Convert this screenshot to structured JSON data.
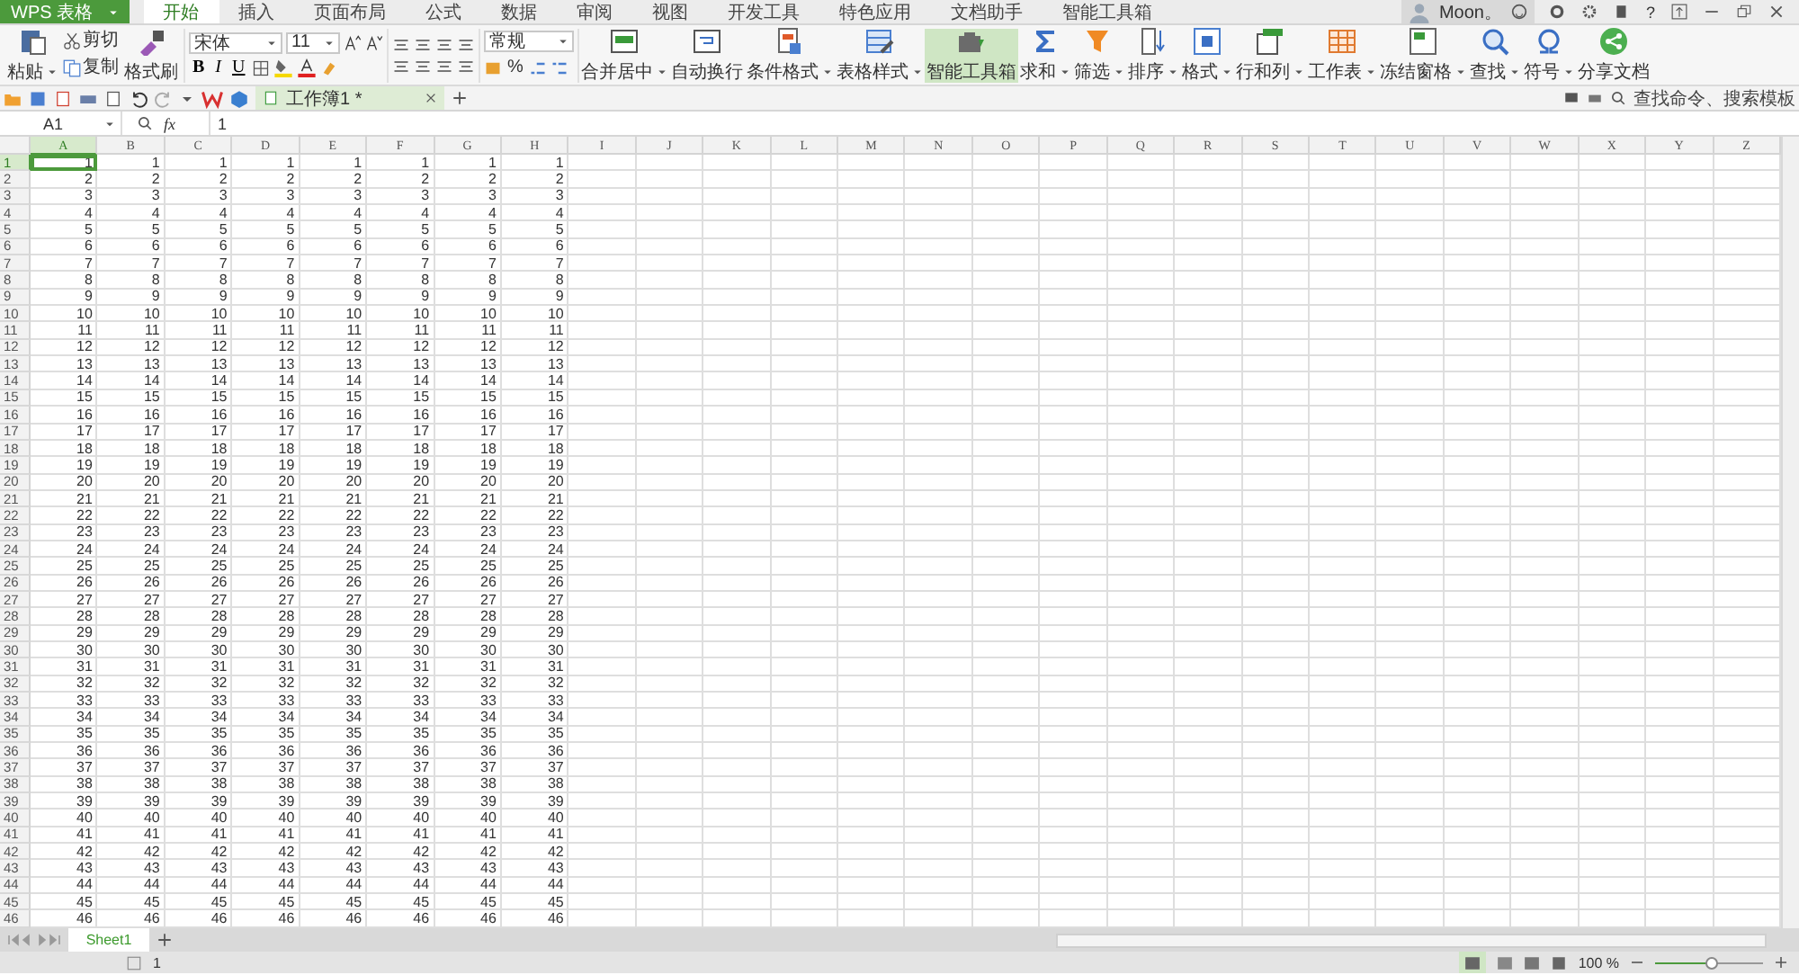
{
  "app_button": {
    "label": "WPS 表格"
  },
  "menu_tabs": [
    {
      "label": "开始",
      "selected": true
    },
    {
      "label": "插入",
      "selected": false
    },
    {
      "label": "页面布局",
      "selected": false
    },
    {
      "label": "公式",
      "selected": false
    },
    {
      "label": "数据",
      "selected": false
    },
    {
      "label": "审阅",
      "selected": false
    },
    {
      "label": "视图",
      "selected": false
    },
    {
      "label": "开发工具",
      "selected": false
    },
    {
      "label": "特色应用",
      "selected": false
    },
    {
      "label": "文档助手",
      "selected": false
    },
    {
      "label": "智能工具箱",
      "selected": false
    }
  ],
  "user": {
    "name": "Moon。",
    "help": "?"
  },
  "ribbon": {
    "clipboard": {
      "paste": "粘贴",
      "cut": "剪切",
      "copy": "复制",
      "format_painter": "格式刷"
    },
    "font": {
      "name": "宋体",
      "size": "11",
      "bold": "B",
      "italic": "I",
      "underline": "U"
    },
    "number": {
      "format": "常规",
      "percent": "%"
    },
    "large_buttons": [
      {
        "label": "合并居中",
        "kind": "merge",
        "dropdown": true,
        "selected": false
      },
      {
        "label": "自动换行",
        "kind": "wrap",
        "dropdown": false,
        "selected": false
      },
      {
        "label": "条件格式",
        "kind": "conditional",
        "dropdown": true,
        "selected": false
      },
      {
        "label": "表格样式",
        "kind": "style",
        "dropdown": true,
        "selected": false
      },
      {
        "label": "智能工具箱",
        "kind": "toolbox",
        "dropdown": false,
        "selected": true
      },
      {
        "label": "求和",
        "kind": "sum",
        "dropdown": true,
        "selected": false
      },
      {
        "label": "筛选",
        "kind": "filter",
        "dropdown": true,
        "selected": false
      },
      {
        "label": "排序",
        "kind": "sort",
        "dropdown": true,
        "selected": false
      },
      {
        "label": "格式",
        "kind": "format",
        "dropdown": true,
        "selected": false
      },
      {
        "label": "行和列",
        "kind": "rowcol",
        "dropdown": true,
        "selected": false
      },
      {
        "label": "工作表",
        "kind": "sheet",
        "dropdown": true,
        "selected": false
      },
      {
        "label": "冻结窗格",
        "kind": "freeze",
        "dropdown": true,
        "selected": false
      },
      {
        "label": "查找",
        "kind": "find",
        "dropdown": true,
        "selected": false
      },
      {
        "label": "符号",
        "kind": "symbol",
        "dropdown": true,
        "selected": false
      },
      {
        "label": "分享文档",
        "kind": "share",
        "dropdown": false,
        "selected": false
      }
    ]
  },
  "quick_bar": {
    "document_tab": "工作簿1 *",
    "search": {
      "placeholder": "查找命令、搜索模板"
    }
  },
  "formula_bar": {
    "cell_ref": "A1",
    "fx": "fx",
    "value": "1"
  },
  "sheet": {
    "columns": [
      {
        "label": "A",
        "selected": true
      },
      {
        "label": "B",
        "selected": false
      },
      {
        "label": "C",
        "selected": false
      },
      {
        "label": "D",
        "selected": false
      },
      {
        "label": "E",
        "selected": false
      },
      {
        "label": "F",
        "selected": false
      },
      {
        "label": "G",
        "selected": false
      },
      {
        "label": "H",
        "selected": false
      },
      {
        "label": "I",
        "selected": false
      },
      {
        "label": "J",
        "selected": false
      },
      {
        "label": "K",
        "selected": false
      },
      {
        "label": "L",
        "selected": false
      },
      {
        "label": "M",
        "selected": false
      },
      {
        "label": "N",
        "selected": false
      },
      {
        "label": "O",
        "selected": false
      },
      {
        "label": "P",
        "selected": false
      },
      {
        "label": "Q",
        "selected": false
      },
      {
        "label": "R",
        "selected": false
      },
      {
        "label": "S",
        "selected": false
      },
      {
        "label": "T",
        "selected": false
      },
      {
        "label": "U",
        "selected": false
      },
      {
        "label": "V",
        "selected": false
      },
      {
        "label": "W",
        "selected": false
      },
      {
        "label": "X",
        "selected": false
      },
      {
        "label": "Y",
        "selected": false
      },
      {
        "label": "Z",
        "selected": false
      }
    ],
    "rows": [
      {
        "label": "1",
        "selected": true,
        "cells": [
          "1",
          "1",
          "1",
          "1",
          "1",
          "1",
          "1",
          "1"
        ]
      },
      {
        "label": "2",
        "selected": false,
        "cells": [
          "2",
          "2",
          "2",
          "2",
          "2",
          "2",
          "2",
          "2"
        ]
      },
      {
        "label": "3",
        "selected": false,
        "cells": [
          "3",
          "3",
          "3",
          "3",
          "3",
          "3",
          "3",
          "3"
        ]
      },
      {
        "label": "4",
        "selected": false,
        "cells": [
          "4",
          "4",
          "4",
          "4",
          "4",
          "4",
          "4",
          "4"
        ]
      },
      {
        "label": "5",
        "selected": false,
        "cells": [
          "5",
          "5",
          "5",
          "5",
          "5",
          "5",
          "5",
          "5"
        ]
      },
      {
        "label": "6",
        "selected": false,
        "cells": [
          "6",
          "6",
          "6",
          "6",
          "6",
          "6",
          "6",
          "6"
        ]
      },
      {
        "label": "7",
        "selected": false,
        "cells": [
          "7",
          "7",
          "7",
          "7",
          "7",
          "7",
          "7",
          "7"
        ]
      },
      {
        "label": "8",
        "selected": false,
        "cells": [
          "8",
          "8",
          "8",
          "8",
          "8",
          "8",
          "8",
          "8"
        ]
      },
      {
        "label": "9",
        "selected": false,
        "cells": [
          "9",
          "9",
          "9",
          "9",
          "9",
          "9",
          "9",
          "9"
        ]
      },
      {
        "label": "10",
        "selected": false,
        "cells": [
          "10",
          "10",
          "10",
          "10",
          "10",
          "10",
          "10",
          "10"
        ]
      },
      {
        "label": "11",
        "selected": false,
        "cells": [
          "11",
          "11",
          "11",
          "11",
          "11",
          "11",
          "11",
          "11"
        ]
      },
      {
        "label": "12",
        "selected": false,
        "cells": [
          "12",
          "12",
          "12",
          "12",
          "12",
          "12",
          "12",
          "12"
        ]
      },
      {
        "label": "13",
        "selected": false,
        "cells": [
          "13",
          "13",
          "13",
          "13",
          "13",
          "13",
          "13",
          "13"
        ]
      },
      {
        "label": "14",
        "selected": false,
        "cells": [
          "14",
          "14",
          "14",
          "14",
          "14",
          "14",
          "14",
          "14"
        ]
      },
      {
        "label": "15",
        "selected": false,
        "cells": [
          "15",
          "15",
          "15",
          "15",
          "15",
          "15",
          "15",
          "15"
        ]
      },
      {
        "label": "16",
        "selected": false,
        "cells": [
          "16",
          "16",
          "16",
          "16",
          "16",
          "16",
          "16",
          "16"
        ]
      },
      {
        "label": "17",
        "selected": false,
        "cells": [
          "17",
          "17",
          "17",
          "17",
          "17",
          "17",
          "17",
          "17"
        ]
      },
      {
        "label": "18",
        "selected": false,
        "cells": [
          "18",
          "18",
          "18",
          "18",
          "18",
          "18",
          "18",
          "18"
        ]
      },
      {
        "label": "19",
        "selected": false,
        "cells": [
          "19",
          "19",
          "19",
          "19",
          "19",
          "19",
          "19",
          "19"
        ]
      },
      {
        "label": "20",
        "selected": false,
        "cells": [
          "20",
          "20",
          "20",
          "20",
          "20",
          "20",
          "20",
          "20"
        ]
      },
      {
        "label": "21",
        "selected": false,
        "cells": [
          "21",
          "21",
          "21",
          "21",
          "21",
          "21",
          "21",
          "21"
        ]
      },
      {
        "label": "22",
        "selected": false,
        "cells": [
          "22",
          "22",
          "22",
          "22",
          "22",
          "22",
          "22",
          "22"
        ]
      },
      {
        "label": "23",
        "selected": false,
        "cells": [
          "23",
          "23",
          "23",
          "23",
          "23",
          "23",
          "23",
          "23"
        ]
      },
      {
        "label": "24",
        "selected": false,
        "cells": [
          "24",
          "24",
          "24",
          "24",
          "24",
          "24",
          "24",
          "24"
        ]
      },
      {
        "label": "25",
        "selected": false,
        "cells": [
          "25",
          "25",
          "25",
          "25",
          "25",
          "25",
          "25",
          "25"
        ]
      },
      {
        "label": "26",
        "selected": false,
        "cells": [
          "26",
          "26",
          "26",
          "26",
          "26",
          "26",
          "26",
          "26"
        ]
      },
      {
        "label": "27",
        "selected": false,
        "cells": [
          "27",
          "27",
          "27",
          "27",
          "27",
          "27",
          "27",
          "27"
        ]
      },
      {
        "label": "28",
        "selected": false,
        "cells": [
          "28",
          "28",
          "28",
          "28",
          "28",
          "28",
          "28",
          "28"
        ]
      },
      {
        "label": "29",
        "selected": false,
        "cells": [
          "29",
          "29",
          "29",
          "29",
          "29",
          "29",
          "29",
          "29"
        ]
      },
      {
        "label": "30",
        "selected": false,
        "cells": [
          "30",
          "30",
          "30",
          "30",
          "30",
          "30",
          "30",
          "30"
        ]
      },
      {
        "label": "31",
        "selected": false,
        "cells": [
          "31",
          "31",
          "31",
          "31",
          "31",
          "31",
          "31",
          "31"
        ]
      },
      {
        "label": "32",
        "selected": false,
        "cells": [
          "32",
          "32",
          "32",
          "32",
          "32",
          "32",
          "32",
          "32"
        ]
      },
      {
        "label": "33",
        "selected": false,
        "cells": [
          "33",
          "33",
          "33",
          "33",
          "33",
          "33",
          "33",
          "33"
        ]
      },
      {
        "label": "34",
        "selected": false,
        "cells": [
          "34",
          "34",
          "34",
          "34",
          "34",
          "34",
          "34",
          "34"
        ]
      },
      {
        "label": "35",
        "selected": false,
        "cells": [
          "35",
          "35",
          "35",
          "35",
          "35",
          "35",
          "35",
          "35"
        ]
      },
      {
        "label": "36",
        "selected": false,
        "cells": [
          "36",
          "36",
          "36",
          "36",
          "36",
          "36",
          "36",
          "36"
        ]
      },
      {
        "label": "37",
        "selected": false,
        "cells": [
          "37",
          "37",
          "37",
          "37",
          "37",
          "37",
          "37",
          "37"
        ]
      },
      {
        "label": "38",
        "selected": false,
        "cells": [
          "38",
          "38",
          "38",
          "38",
          "38",
          "38",
          "38",
          "38"
        ]
      },
      {
        "label": "39",
        "selected": false,
        "cells": [
          "39",
          "39",
          "39",
          "39",
          "39",
          "39",
          "39",
          "39"
        ]
      },
      {
        "label": "40",
        "selected": false,
        "cells": [
          "40",
          "40",
          "40",
          "40",
          "40",
          "40",
          "40",
          "40"
        ]
      },
      {
        "label": "41",
        "selected": false,
        "cells": [
          "41",
          "41",
          "41",
          "41",
          "41",
          "41",
          "41",
          "41"
        ]
      },
      {
        "label": "42",
        "selected": false,
        "cells": [
          "42",
          "42",
          "42",
          "42",
          "42",
          "42",
          "42",
          "42"
        ]
      },
      {
        "label": "43",
        "selected": false,
        "cells": [
          "43",
          "43",
          "43",
          "43",
          "43",
          "43",
          "43",
          "43"
        ]
      },
      {
        "label": "44",
        "selected": false,
        "cells": [
          "44",
          "44",
          "44",
          "44",
          "44",
          "44",
          "44",
          "44"
        ]
      },
      {
        "label": "45",
        "selected": false,
        "cells": [
          "45",
          "45",
          "45",
          "45",
          "45",
          "45",
          "45",
          "45"
        ]
      },
      {
        "label": "46",
        "selected": false,
        "cells": [
          "46",
          "46",
          "46",
          "46",
          "46",
          "46",
          "46",
          "46"
        ]
      }
    ]
  },
  "sheet_tabs": [
    {
      "label": "Sheet1",
      "selected": true
    }
  ],
  "status_bar": {
    "page": "1",
    "zoom": "100 %",
    "zoom_slider": {
      "level": 0.52
    }
  }
}
